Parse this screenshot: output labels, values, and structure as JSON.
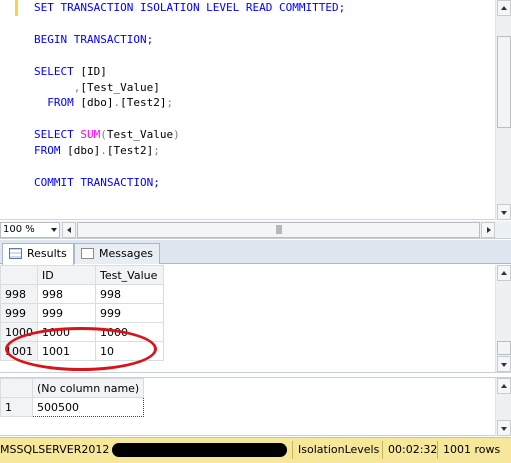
{
  "editor": {
    "lines": {
      "l1": "SET TRANSACTION ISOLATION LEVEL READ COMMITTED;",
      "l3": "BEGIN TRANSACTION;",
      "l5a": "SELECT",
      "l5b": "[ID]",
      "l6a": ",",
      "l6b": "[Test_Value]",
      "l7a": "FROM",
      "l7b": "[dbo]",
      "l7c": ".",
      "l7d": "[Test2]",
      "l7e": ";",
      "l9a": "SELECT",
      "l9b": "SUM",
      "l9c": "(",
      "l9d": "Test_Value",
      "l9e": ")",
      "l10a": "FROM",
      "l10b": "[dbo]",
      "l10c": ".",
      "l10d": "[Test2]",
      "l10e": ";",
      "l12": "COMMIT TRANSACTION;"
    },
    "colors": {
      "keyword": "#0000ff",
      "function": "#ff00ff",
      "operator": "#808080"
    }
  },
  "zoom": {
    "value": "100 %"
  },
  "tabs": [
    {
      "label": "Results",
      "icon": "grid-icon",
      "active": true
    },
    {
      "label": "Messages",
      "icon": "messages-icon",
      "active": false
    }
  ],
  "results1": {
    "columns": [
      "ID",
      "Test_Value"
    ],
    "rows": [
      {
        "num": "998",
        "id": "998",
        "value": "998"
      },
      {
        "num": "999",
        "id": "999",
        "value": "999"
      },
      {
        "num": "1000",
        "id": "1000",
        "value": "1000"
      },
      {
        "num": "1001",
        "id": "1001",
        "value": "10"
      }
    ]
  },
  "results2": {
    "columns": [
      "(No column name)"
    ],
    "rows": [
      {
        "num": "1",
        "value": "500500"
      }
    ]
  },
  "status": {
    "server": "MSSQLSERVER2012",
    "database": "IsolationLevels",
    "elapsed": "00:02:32",
    "rows": "1001 rows",
    "color": "#f6e79a"
  }
}
